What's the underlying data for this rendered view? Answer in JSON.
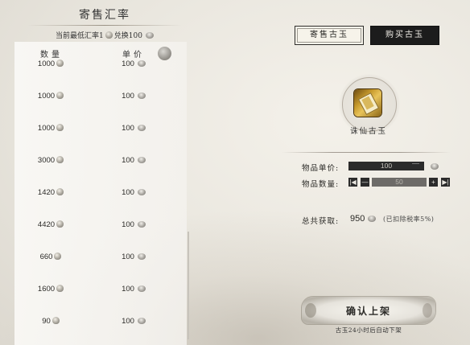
{
  "left_panel": {
    "title": "寄售汇率",
    "rate_prefix": "当前最低汇率1",
    "rate_mid": "兑换100",
    "headers": {
      "quantity": "数量",
      "unit_price": "单价"
    },
    "rows": [
      {
        "quantity": "1000",
        "price": "100"
      },
      {
        "quantity": "1000",
        "price": "100"
      },
      {
        "quantity": "1000",
        "price": "100"
      },
      {
        "quantity": "3000",
        "price": "100"
      },
      {
        "quantity": "1420",
        "price": "100"
      },
      {
        "quantity": "4420",
        "price": "100"
      },
      {
        "quantity": "660",
        "price": "100"
      },
      {
        "quantity": "1600",
        "price": "100"
      },
      {
        "quantity": "90",
        "price": "100"
      }
    ]
  },
  "tabs": {
    "sell": "寄售古玉",
    "buy": "购买古玉"
  },
  "item": {
    "name": "诛仙古玉"
  },
  "form": {
    "unit_price_label": "物品单价:",
    "unit_price_value": "100",
    "quantity_label": "物品数量:",
    "quantity_value": "50",
    "first_btn": "|◀",
    "minus_btn": "—",
    "plus_btn": "+",
    "last_btn": "▶|",
    "total_label": "总共获取:",
    "total_value": "950",
    "fee_note": "(已扣除税率5%)"
  },
  "confirm": {
    "label": "确认上架",
    "note": "古玉24小时后自动下架"
  }
}
